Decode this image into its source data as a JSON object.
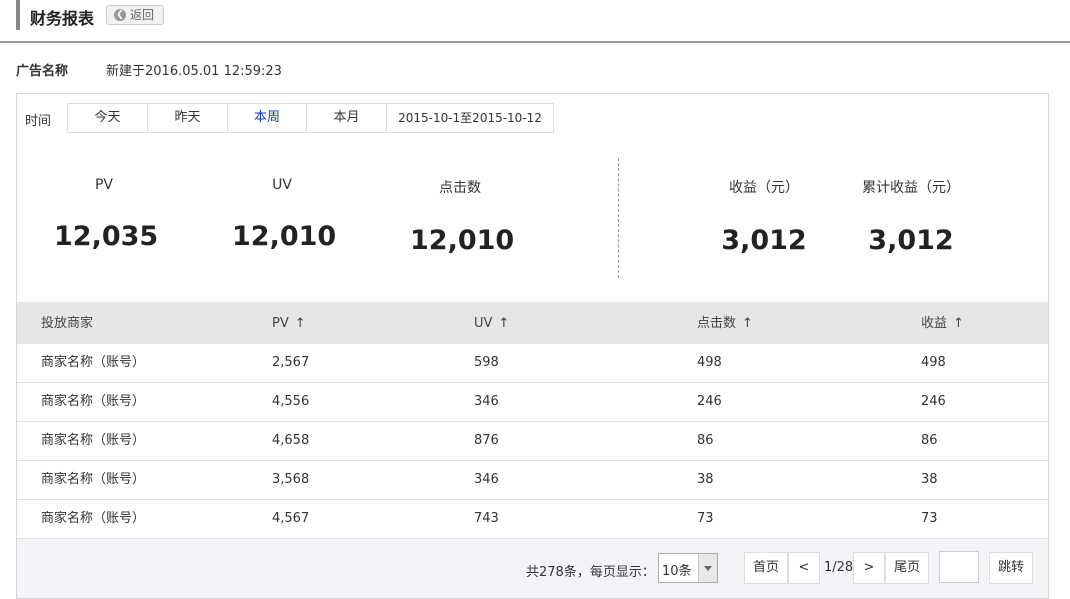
{
  "header": {
    "title": "财务报表",
    "back_label": "返回"
  },
  "ad": {
    "label": "广告名称",
    "created": "新建于2016.05.01  12:59:23"
  },
  "time_filter": {
    "label": "时间",
    "tabs": [
      "今天",
      "昨天",
      "本周",
      "本月",
      "2015-10-1至2015-10-12"
    ],
    "active": "本周"
  },
  "stats": [
    {
      "label": "PV",
      "value": "12,035"
    },
    {
      "label": "UV",
      "value": "12,010"
    },
    {
      "label": "点击数",
      "value": "12,010"
    },
    {
      "label": "收益（元）",
      "value": "3,012"
    },
    {
      "label": "累计收益（元）",
      "value": "3,012"
    }
  ],
  "table": {
    "columns": [
      "投放商家",
      "PV",
      "UV",
      "点击数",
      "收益"
    ],
    "sort_arrow": "↑",
    "rows": [
      [
        "商家名称（账号）",
        "2,567",
        "598",
        "498",
        "498"
      ],
      [
        "商家名称（账号）",
        "4,556",
        "346",
        "246",
        "246"
      ],
      [
        "商家名称（账号）",
        "4,658",
        "876",
        "86",
        "86"
      ],
      [
        "商家名称（账号）",
        "3,568",
        "346",
        "38",
        "38"
      ],
      [
        "商家名称（账号）",
        "4,567",
        "743",
        "73",
        "73"
      ]
    ]
  },
  "pagination": {
    "total_text": "共278条，每页显示：",
    "page_size": "10条",
    "first": "首页",
    "prev": "<",
    "info": "1/28",
    "next": ">",
    "last": "尾页",
    "jump": "跳转"
  },
  "colors": {
    "active_tab": "#1a36b8",
    "table_header_bg": "#e6e6e6",
    "footer_bg": "#f2f4f8"
  }
}
